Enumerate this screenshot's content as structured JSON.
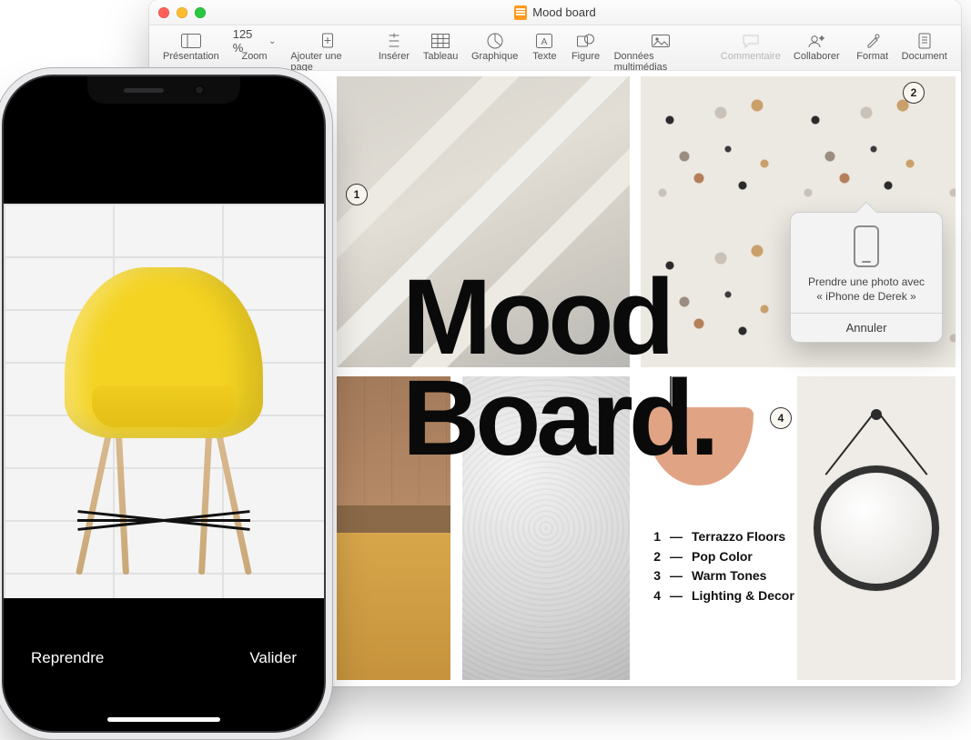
{
  "window": {
    "title": "Mood board",
    "traffic": {
      "close": "close",
      "minimize": "minimize",
      "zoom": "zoom"
    }
  },
  "toolbar": {
    "presentation": "Présentation",
    "zoom_label": "Zoom",
    "zoom_value": "125 %",
    "add_page": "Ajouter une page",
    "insert": "Insérer",
    "table": "Tableau",
    "chart": "Graphique",
    "text": "Texte",
    "shape": "Figure",
    "media": "Données multimédias",
    "comment": "Commentaire",
    "collaborate": "Collaborer",
    "format": "Format",
    "document": "Document"
  },
  "document": {
    "heading_line1": "Mood",
    "heading_line2": "Board.",
    "badges": {
      "one": "1",
      "two": "2",
      "four": "4"
    },
    "legend": [
      {
        "num": "1",
        "label": "Terrazzo Floors"
      },
      {
        "num": "2",
        "label": "Pop Color"
      },
      {
        "num": "3",
        "label": "Warm Tones"
      },
      {
        "num": "4",
        "label": "Lighting & Decor"
      }
    ]
  },
  "popover": {
    "text": "Prendre une photo avec « iPhone de Derek »",
    "cancel": "Annuler"
  },
  "iphone": {
    "retake": "Reprendre",
    "use": "Valider"
  }
}
